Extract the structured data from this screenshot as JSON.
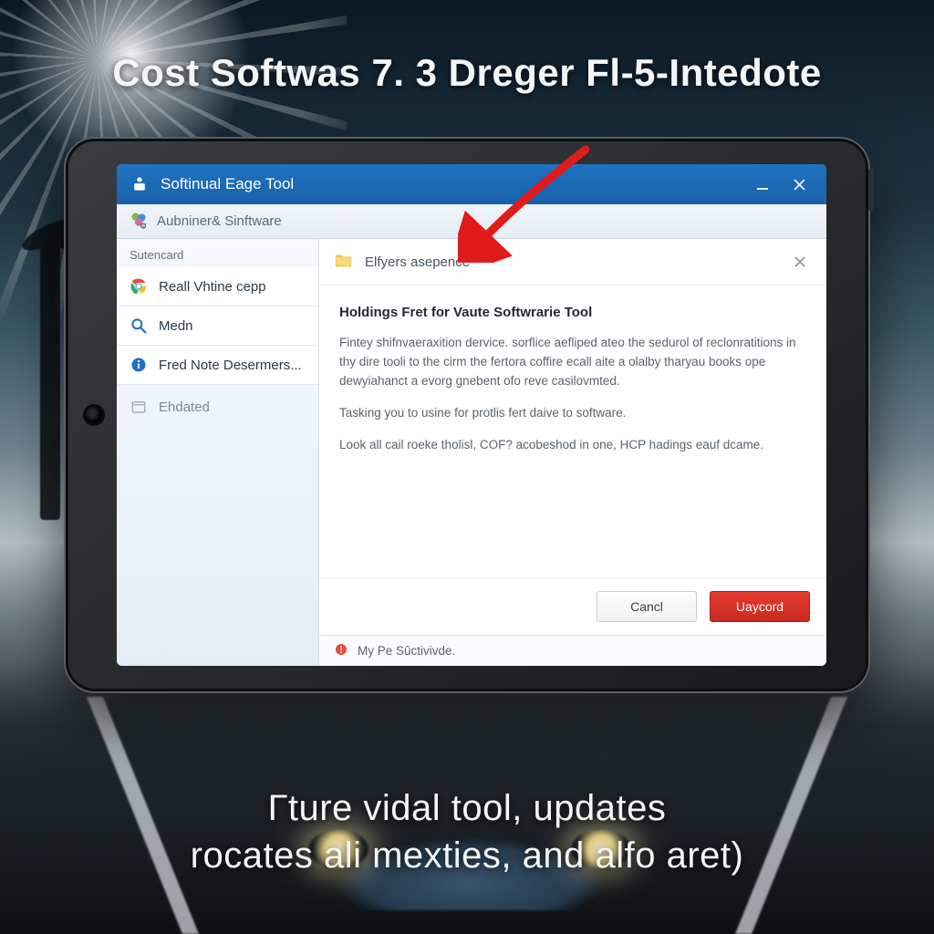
{
  "overlay": {
    "headline": "Cost Softwas 7. 3 Dreger Fl-5-Intedote",
    "subline_l1": "Гture vidal tool, updates",
    "subline_l2": "rocates ali mexties, and alfo aret)"
  },
  "window": {
    "title": "Softinual Eage Tool",
    "min_label": "Minimize",
    "close_label": "Close"
  },
  "toolbar": {
    "label": "Aubniner& Sinftware"
  },
  "sidebar": {
    "section": "Sutencard",
    "items": [
      {
        "label": "Reall Vhtine cepp",
        "icon": "chrome-icon"
      },
      {
        "label": "Medn",
        "icon": "magnifier-icon"
      },
      {
        "label": "Fred Note Desermers...",
        "icon": "info-icon"
      }
    ],
    "muted_label": "Ehdated"
  },
  "panel": {
    "header": "Elfyers asepence",
    "title": "Holdings Fret for Vaute Softwrarie Tool",
    "para1": "Fintey shifnvaeraxition dervice. sorflice aefliped ateo the sedurol of reclonratitions in thy dire tooli to the cirm the fertora coffire ecall aite a olalby tharyau books ope dewyiahanct a evorg gnebent ofo reve casilovmted.",
    "para2": "Tasking you to usine for protlis fert daive to software.",
    "para3": "Look all cail roeke tholisl, COF? acobeshod in one, HCP hadings eauf dcame."
  },
  "buttons": {
    "cancel": "Cancl",
    "primary": "Uaycord"
  },
  "status": {
    "text": "My Pe Sûctivivde."
  }
}
